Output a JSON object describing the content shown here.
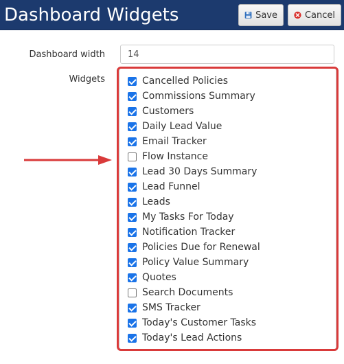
{
  "header": {
    "title": "Dashboard Widgets",
    "save_label": "Save",
    "cancel_label": "Cancel"
  },
  "form": {
    "width_label": "Dashboard width",
    "width_value": "14",
    "widgets_label": "Widgets"
  },
  "colors": {
    "header_bg": "#1c3a6e",
    "checkbox_accent": "#1a73e8",
    "highlight": "#d93a3a"
  },
  "widgets": [
    {
      "label": "Cancelled Policies",
      "checked": true
    },
    {
      "label": "Commissions Summary",
      "checked": true
    },
    {
      "label": "Customers",
      "checked": true
    },
    {
      "label": "Daily Lead Value",
      "checked": true
    },
    {
      "label": "Email Tracker",
      "checked": true
    },
    {
      "label": "Flow Instance",
      "checked": false
    },
    {
      "label": "Lead 30 Days Summary",
      "checked": true
    },
    {
      "label": "Lead Funnel",
      "checked": true
    },
    {
      "label": "Leads",
      "checked": true
    },
    {
      "label": "My Tasks For Today",
      "checked": true
    },
    {
      "label": "Notification Tracker",
      "checked": true
    },
    {
      "label": "Policies Due for Renewal",
      "checked": true
    },
    {
      "label": "Policy Value Summary",
      "checked": true
    },
    {
      "label": "Quotes",
      "checked": true
    },
    {
      "label": "Search Documents",
      "checked": false
    },
    {
      "label": "SMS Tracker",
      "checked": true
    },
    {
      "label": "Today's Customer Tasks",
      "checked": true
    },
    {
      "label": "Today's Lead Actions",
      "checked": true
    }
  ]
}
